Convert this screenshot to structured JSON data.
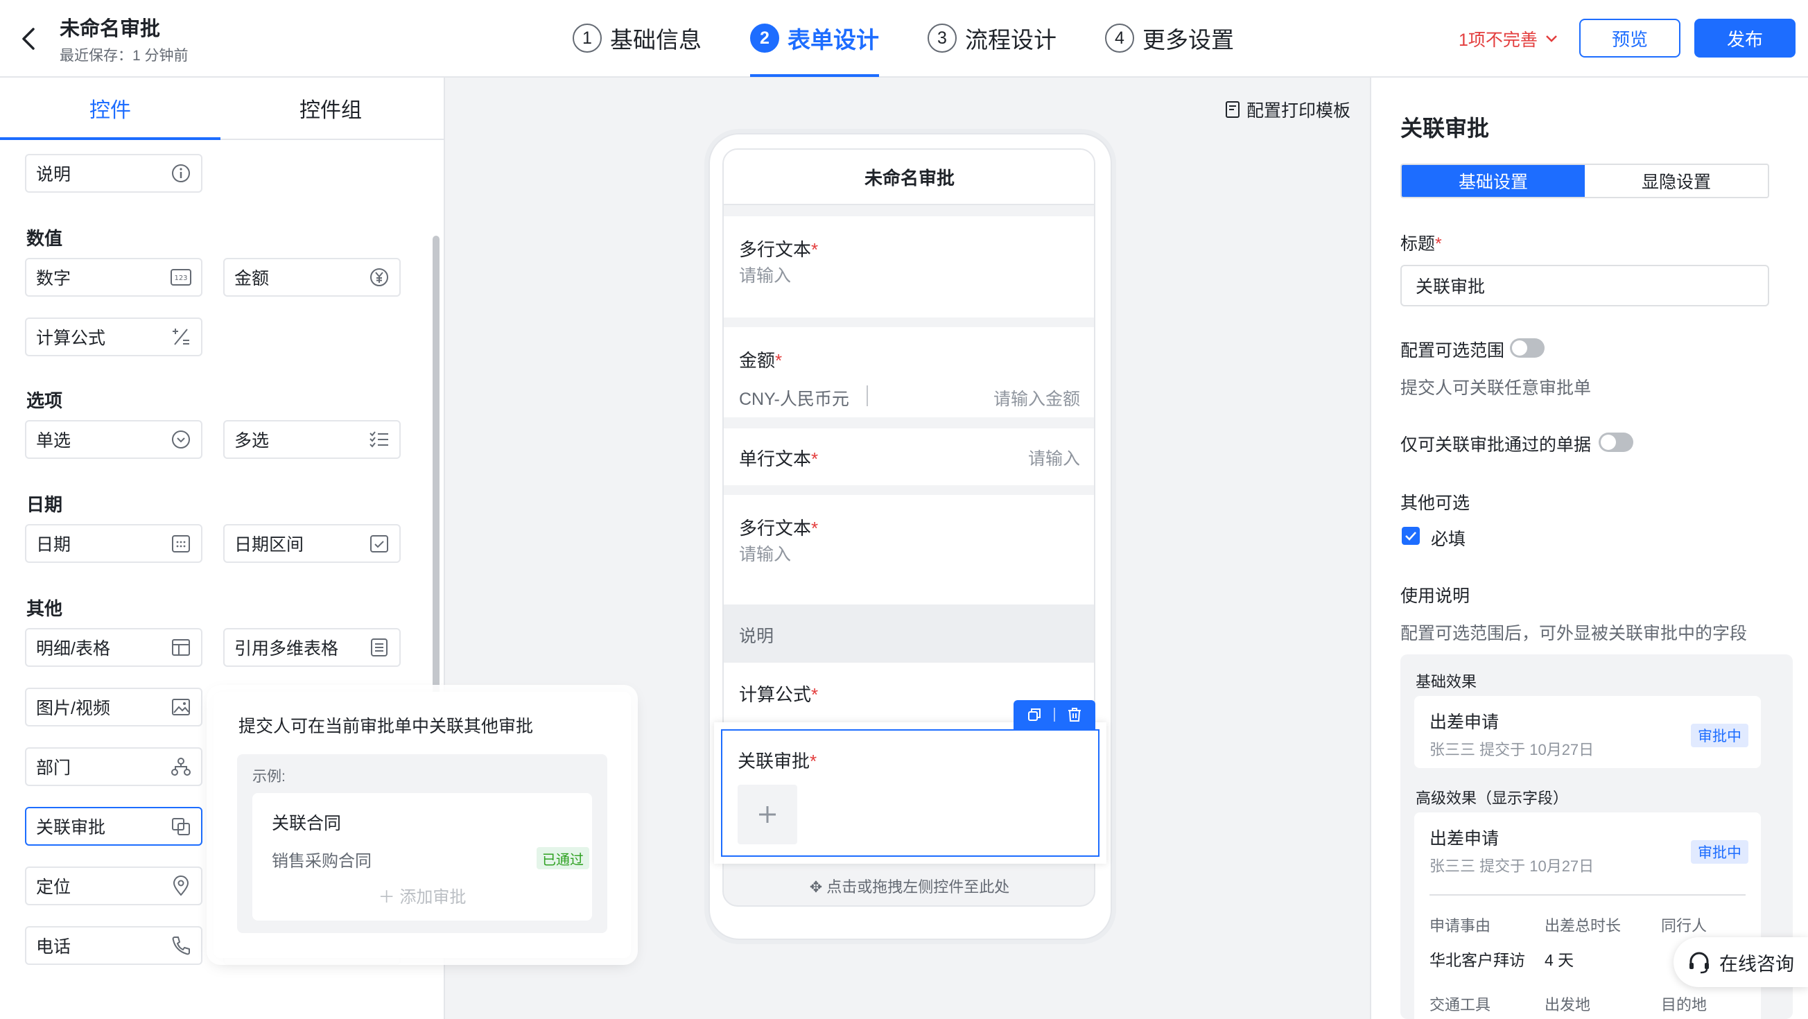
{
  "header": {
    "title": "未命名审批",
    "save_status": "最近保存：1 分钟前",
    "steps": [
      {
        "num": "1",
        "label": "基础信息"
      },
      {
        "num": "2",
        "label": "表单设计"
      },
      {
        "num": "3",
        "label": "流程设计"
      },
      {
        "num": "4",
        "label": "更多设置"
      }
    ],
    "active_step": 2,
    "warning": "1项不完善",
    "preview_label": "预览",
    "publish_label": "发布"
  },
  "left_panel": {
    "tabs": [
      "控件",
      "控件组"
    ],
    "active_tab": 0,
    "top_item": "说明",
    "sections": {
      "numeric": {
        "title": "数值",
        "items": [
          "数字",
          "金额",
          "计算公式"
        ]
      },
      "options": {
        "title": "选项",
        "items": [
          "单选",
          "多选"
        ]
      },
      "date": {
        "title": "日期",
        "items": [
          "日期",
          "日期区间"
        ]
      },
      "other": {
        "title": "其他",
        "items": [
          "明细/表格",
          "引用多维表格",
          "图片/视频",
          "部门",
          "关联审批",
          "定位",
          "电话"
        ]
      }
    }
  },
  "canvas": {
    "print_template": "配置打印模板",
    "form_title": "未命名审批",
    "fields": {
      "multiline1": {
        "label": "多行文本",
        "placeholder": "请输入"
      },
      "amount": {
        "label": "金额",
        "currency": "CNY-人民币元",
        "placeholder": "请输入金额"
      },
      "singleline": {
        "label": "单行文本",
        "placeholder": "请输入"
      },
      "multiline2": {
        "label": "多行文本",
        "placeholder": "请输入"
      },
      "description": {
        "label": "说明"
      },
      "formula": {
        "label": "计算公式"
      },
      "related": {
        "label": "关联审批"
      }
    },
    "required_mark": "*",
    "drop_hint": "点击或拖拽左侧控件至此处"
  },
  "tooltip": {
    "title": "提交人可在当前审批单中关联其他审批",
    "example_label": "示例:",
    "card_title": "关联合同",
    "card_sub": "销售采购合同",
    "badge": "已通过",
    "add_label": "添加审批"
  },
  "right_panel": {
    "title": "关联审批",
    "tabs": [
      "基础设置",
      "显隐设置"
    ],
    "active_tab": 0,
    "title_label": "标题",
    "title_value": "关联审批",
    "scope_label": "配置可选范围",
    "scope_desc": "提交人可关联任意审批单",
    "approved_only_label": "仅可关联审批通过的单据",
    "other_label": "其他可选",
    "required_label": "必填",
    "usage_label": "使用说明",
    "usage_desc": "配置可选范围后，可外显被关联审批中的字段",
    "demo": {
      "basic_label": "基础效果",
      "advanced_label": "高级效果（显示字段）",
      "card_title": "出差申请",
      "card_sub": "张三三 提交于 10月27日",
      "badge": "审批中",
      "fields": [
        {
          "key": "申请事由",
          "value": "华北客户拜访"
        },
        {
          "key": "出差总时长",
          "value": "4 天"
        },
        {
          "key": "同行人",
          "value": ""
        }
      ],
      "fields2": [
        "交通工具",
        "出发地",
        "目的地"
      ]
    }
  },
  "consult_label": "在线咨询",
  "colors": {
    "primary": "#1d6dff",
    "danger": "#e33d3d",
    "success": "#2ea121"
  }
}
